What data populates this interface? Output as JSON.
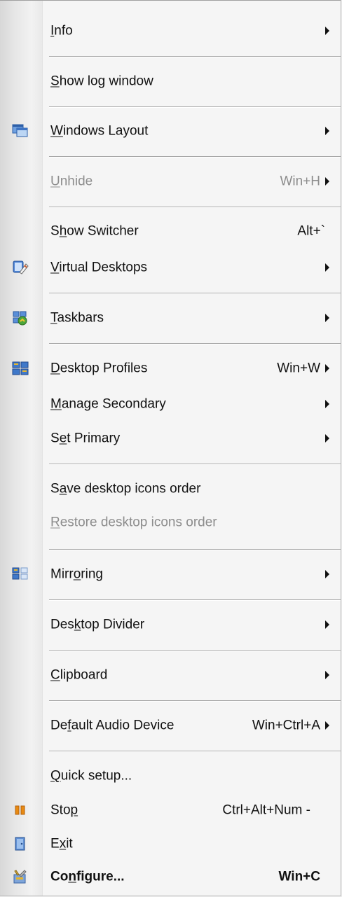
{
  "menu": {
    "info": {
      "label": "Info",
      "mn": "I",
      "rest": "nfo"
    },
    "show_log": {
      "pre": "",
      "mn": "S",
      "rest": "how log window"
    },
    "windows_layout": {
      "pre": "",
      "mn": "W",
      "rest": "indows Layout",
      "icon": "windows-layout-icon"
    },
    "unhide": {
      "pre": "",
      "mn": "U",
      "rest": "nhide",
      "shortcut": "Win+H"
    },
    "show_switcher": {
      "pre": "S",
      "mn": "h",
      "rest": "ow Switcher",
      "shortcut": "Alt+`"
    },
    "virtual_desktops": {
      "pre": "",
      "mn": "V",
      "rest": "irtual Desktops",
      "icon": "virtual-desktops-icon"
    },
    "taskbars": {
      "pre": "",
      "mn": "T",
      "rest": "askbars",
      "icon": "taskbars-icon"
    },
    "desktop_profiles": {
      "pre": "",
      "mn": "D",
      "rest": "esktop Profiles",
      "shortcut": "Win+W",
      "icon": "desktop-profiles-icon"
    },
    "manage_secondary": {
      "pre": "",
      "mn": "M",
      "rest": "anage Secondary"
    },
    "set_primary": {
      "pre": "S",
      "mn": "e",
      "rest": "t Primary"
    },
    "save_icons": {
      "pre": "S",
      "mn": "a",
      "rest": "ve desktop icons order"
    },
    "restore_icons": {
      "pre": "",
      "mn": "R",
      "rest": "estore desktop icons order"
    },
    "mirroring": {
      "pre": "Mirr",
      "mn": "o",
      "rest": "ring",
      "icon": "mirroring-icon"
    },
    "desktop_divider": {
      "pre": "Des",
      "mn": "k",
      "rest": "top Divider"
    },
    "clipboard": {
      "pre": "",
      "mn": "C",
      "rest": "lipboard"
    },
    "default_audio": {
      "pre": "De",
      "mn": "f",
      "rest": "ault Audio Device",
      "shortcut": "Win+Ctrl+A"
    },
    "quick_setup": {
      "pre": "",
      "mn": "Q",
      "rest": "uick setup..."
    },
    "stop": {
      "pre": "Sto",
      "mn": "p",
      "rest": "",
      "shortcut": "Ctrl+Alt+Num -",
      "icon": "pause-icon"
    },
    "exit": {
      "pre": "E",
      "mn": "x",
      "rest": "it",
      "icon": "exit-door-icon"
    },
    "configure": {
      "pre": "Co",
      "mn": "n",
      "rest": "figure...",
      "shortcut": "Win+C",
      "icon": "configure-tools-icon"
    }
  },
  "colors": {
    "text": "#111111",
    "disabled_text": "#8d8d8d",
    "separator": "#a8a8a8",
    "gutter": "#e0e0e0"
  }
}
